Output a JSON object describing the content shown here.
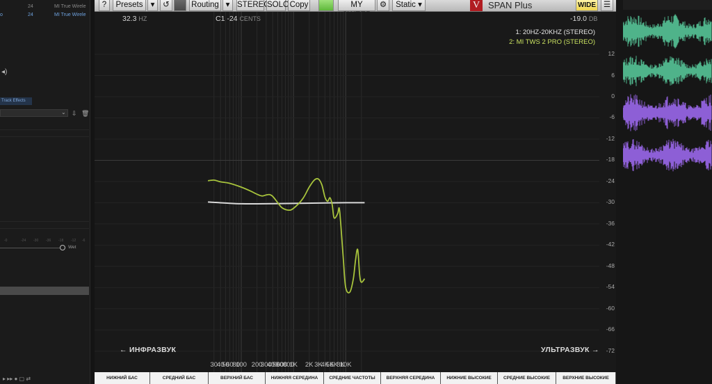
{
  "toolbar": {
    "help": "?",
    "presets": "Presets",
    "presets_arrow": "▾",
    "reset_icon": "↺",
    "routing": "Routing",
    "routing_arrow": "▾",
    "stereo": "STEREO",
    "solo": "SOLO",
    "copy": "Copy",
    "sweep": "MY SWEEP",
    "settings_icon": "⚙",
    "static": "Static ▾",
    "logo": "V",
    "title": "SPAN Plus",
    "wide": "WIDE",
    "menu_icon": "☰"
  },
  "readout": {
    "freq": "32.3",
    "freq_unit": "HZ",
    "note": "C1  -24",
    "note_unit": "CENTS",
    "db": "-19.0",
    "db_unit": "DB"
  },
  "legend": {
    "s1": "1: 20HZ-20KHZ (STEREO)",
    "s2": "2: MI TWS 2 PRO (STEREO)"
  },
  "annotations": {
    "infra": "← ИНФРАЗВУК",
    "ultra": "УЛЬТРАЗВУК →"
  },
  "bands": [
    "НИЖНИЙ БАС",
    "СРЕДНИЙ БАС",
    "ВЕРХНИЙ БАС",
    "НИЖНЯЯ СЕРЕДИНА",
    "СРЕДНИЕ ЧАСТОТЫ",
    "ВЕРХНЯЯ СЕРЕДИНА",
    "НИЖНИЕ ВЫСОКИЕ",
    "СРЕДНИЕ ВЫСОКИЕ",
    "ВЕРХНИЕ ВЫСОКИЕ"
  ],
  "left_panel": {
    "track1_num": "24",
    "track1_name": "MI True Wirele",
    "track2_label": "o",
    "track2_num": "24",
    "track2_name": "MI True Wirele",
    "track_effects": "Track Effects",
    "wet_label": "Wet",
    "meter_ticks": [
      "-0",
      "-24",
      "-30",
      "-36",
      "-18",
      "-12",
      "-6"
    ]
  },
  "colors": {
    "series1": "#d9d9d9",
    "series2": "#a8c43c",
    "wave_green": "#4fb38a",
    "wave_purple": "#8d5fd6"
  },
  "chart_data": {
    "type": "line",
    "x_scale": "log",
    "xlim": [
      23,
      23000
    ],
    "ylim": [
      -75,
      6
    ],
    "grid": true,
    "x_ticks": [
      30,
      40,
      50,
      60,
      80,
      100,
      200,
      300,
      400,
      500,
      600,
      800,
      1000,
      2000,
      3000,
      4000,
      5000,
      6000,
      8000,
      10000
    ],
    "x_tick_labels": [
      "30",
      "40",
      "50",
      "60",
      "80",
      "100",
      "200",
      "300",
      "400",
      "500",
      "600",
      "800",
      "1K",
      "2K",
      "3K",
      "4K",
      "5K",
      "6K",
      "8K",
      "10K"
    ],
    "y_ticks": [
      12,
      6,
      0,
      -6,
      -12,
      -18,
      -24,
      -30,
      -36,
      -42,
      -48,
      -54,
      -60,
      -66,
      -72
    ],
    "y_tick_labels": [
      "12",
      "6",
      "0",
      "-6",
      "-12",
      "-18",
      "-24",
      "-30",
      "-36",
      "-42",
      "-48",
      "-54",
      "-60",
      "-66",
      "-72"
    ],
    "y_unit": "DB",
    "legend_position": "top-right",
    "series": [
      {
        "name": "1: 20HZ-20KHZ (STEREO)",
        "x": [
          23,
          30,
          50,
          100,
          300,
          1000,
          3000,
          10000,
          23000
        ],
        "y": [
          -29.8,
          -29.9,
          -30.1,
          -30.3,
          -30.3,
          -30.2,
          -30.1,
          -30.0,
          -30.0
        ]
      },
      {
        "name": "2: MI TWS 2 PRO (STEREO)",
        "x": [
          23,
          30,
          40,
          60,
          100,
          150,
          200,
          250,
          300,
          350,
          400,
          500,
          600,
          800,
          1000,
          1500,
          2000,
          2500,
          3000,
          3500,
          4000,
          4500,
          5000,
          5500,
          6000,
          7000,
          7500,
          8000,
          9000,
          10000,
          12000,
          14000,
          15500,
          17000,
          18500,
          20000,
          23000
        ],
        "y": [
          -23.8,
          -23.6,
          -24.1,
          -24.5,
          -25.6,
          -26.7,
          -27.6,
          -28.1,
          -27.8,
          -27.7,
          -28.2,
          -30.0,
          -31.4,
          -32.1,
          -31.6,
          -28.9,
          -25.6,
          -23.6,
          -23.3,
          -25.0,
          -28.4,
          -29.6,
          -28.6,
          -30.5,
          -34.3,
          -33.1,
          -31.5,
          -35.5,
          -46.0,
          -54.0,
          -55.3,
          -51.5,
          -46.0,
          -43.3,
          -50.5,
          -52.5,
          -51.5
        ]
      }
    ]
  }
}
